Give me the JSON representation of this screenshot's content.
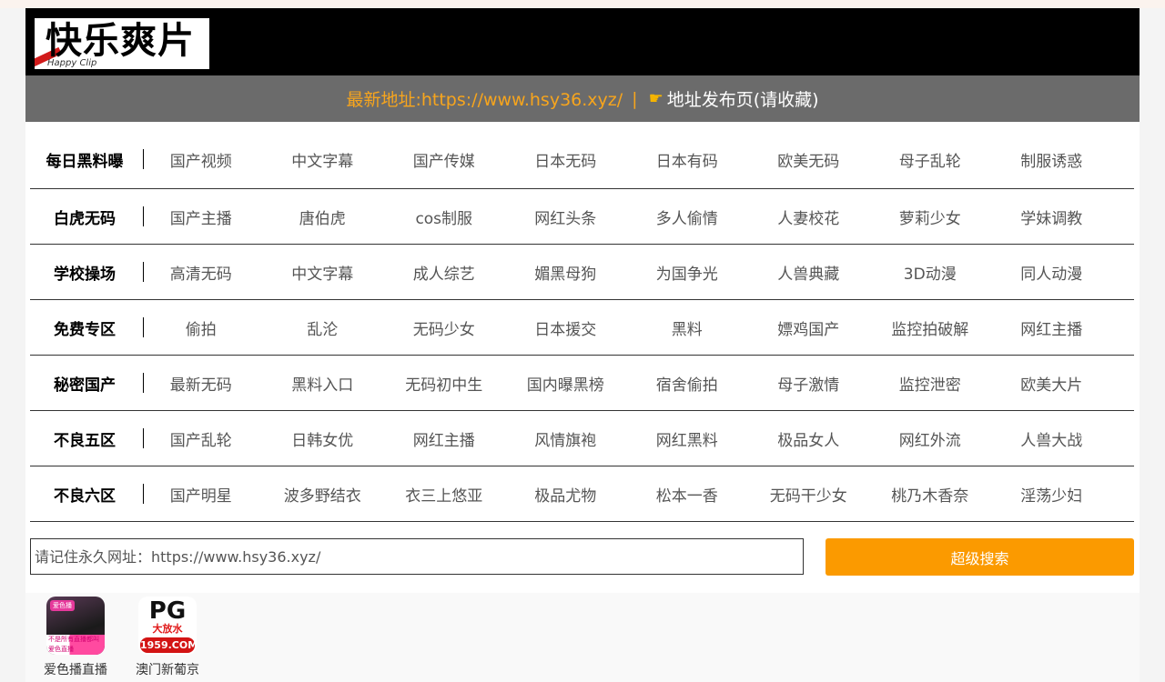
{
  "logo": {
    "text": "快乐爽片",
    "sub": "Happy Clip"
  },
  "banner": {
    "address_text": "最新地址:https://www.hsy36.xyz/",
    "separator": "|",
    "hand_icon": "pointing-hand-icon",
    "publish_text": "地址发布页(请收藏)"
  },
  "categories": [
    {
      "title": "每日黑料曝",
      "links": [
        "国产视频",
        "中文字幕",
        "国产传媒",
        "日本无码",
        "日本有码",
        "欧美无码",
        "母子乱轮",
        "制服诱惑"
      ]
    },
    {
      "title": "白虎无码",
      "links": [
        "国产主播",
        "唐伯虎",
        "cos制服",
        "网红头条",
        "多人偷情",
        "人妻校花",
        "萝莉少女",
        "学妹调教"
      ]
    },
    {
      "title": "学校操场",
      "links": [
        "高清无码",
        "中文字幕",
        "成人综艺",
        "媚黑母狗",
        "为国争光",
        "人兽典藏",
        "3D动漫",
        "同人动漫"
      ]
    },
    {
      "title": "免费专区",
      "links": [
        "偷拍",
        "乱沦",
        "无码少女",
        "日本援交",
        "黑料",
        "嫖鸡国产",
        "监控拍破解",
        "网红主播"
      ]
    },
    {
      "title": "秘密国产",
      "links": [
        "最新无码",
        "黑料入口",
        "无码初中生",
        "国内曝黑榜",
        "宿舍偷拍",
        "母子激情",
        "监控泄密",
        "欧美大片"
      ]
    },
    {
      "title": "不良五区",
      "links": [
        "国产乱轮",
        "日韩女优",
        "网红主播",
        "风情旗袍",
        "网红黑料",
        "极品女人",
        "网红外流",
        "人兽大战"
      ]
    },
    {
      "title": "不良六区",
      "links": [
        "国产明星",
        "波多野结衣",
        "衣三上悠亚",
        "极品尤物",
        "松本一香",
        "无码干少女",
        "桃乃木香奈",
        "淫荡少妇"
      ]
    }
  ],
  "search": {
    "placeholder": "请记住永久网址：https://www.hsy36.xyz/",
    "button_label": "超级搜索"
  },
  "apps": [
    {
      "name": "爱色播直播",
      "icon_tag": "爱色播",
      "icon_bottom": "不是所有直播都叫爱色直播"
    },
    {
      "name": "澳门新葡京",
      "icon_pg": "PG",
      "icon_big": "大放水",
      "icon_site": "1959.COM"
    }
  ],
  "colors": {
    "accent": "#fb9a00",
    "banner_bg": "#6b6b6b",
    "address": "#f7a51d"
  }
}
